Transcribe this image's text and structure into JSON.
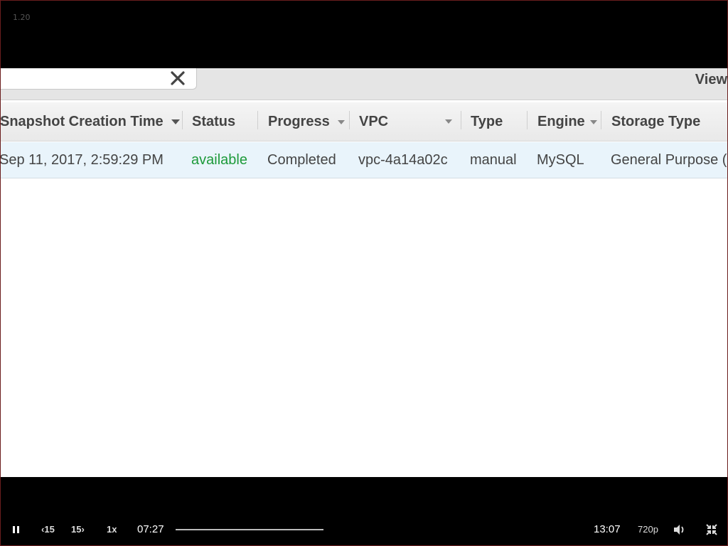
{
  "overlay": {
    "version": "1.20"
  },
  "console": {
    "search": {
      "value": "",
      "clear_icon": "close-icon"
    },
    "view_label": "View",
    "columns": [
      {
        "label": "Snapshot Creation Time",
        "sortable": true
      },
      {
        "label": "Status",
        "sortable": false
      },
      {
        "label": "Progress",
        "sortable": true
      },
      {
        "label": "VPC",
        "sortable": true
      },
      {
        "label": "Type",
        "sortable": false
      },
      {
        "label": "Engine",
        "sortable": true
      },
      {
        "label": "Storage Type",
        "sortable": false
      }
    ],
    "rows": [
      {
        "creation_time": "Sep 11, 2017, 2:59:29 PM",
        "status": "available",
        "progress": "Completed",
        "vpc": "vpc-4a14a02c",
        "type": "manual",
        "engine": "MySQL",
        "storage_type": "General Purpose (S"
      }
    ],
    "status_color": "#1d9a3a",
    "row_highlight": "#e9f4fb"
  },
  "player": {
    "play_state_icon": "pause-icon",
    "rewind_label": "15",
    "forward_label": "15",
    "speed": "1x",
    "current_time": "07:27",
    "duration": "13:07",
    "quality": "720p",
    "volume_icon": "volume-icon",
    "fullscreen_icon": "exit-fullscreen-icon"
  }
}
